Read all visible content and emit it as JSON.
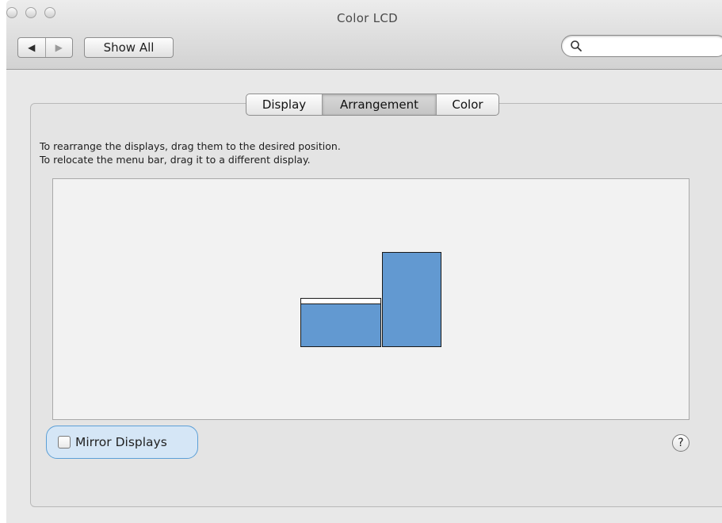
{
  "window": {
    "title": "Color LCD"
  },
  "toolbar": {
    "back_icon": "back-arrow-icon",
    "forward_icon": "forward-arrow-icon",
    "show_all_label": "Show All",
    "search_placeholder": "",
    "search_value": ""
  },
  "tabs": [
    {
      "label": "Display"
    },
    {
      "label": "Arrangement",
      "selected": true
    },
    {
      "label": "Color"
    }
  ],
  "instructions": {
    "line1": "To rearrange the displays, drag them to the desired position.",
    "line2": "To relocate the menu bar, drag it to a different display."
  },
  "arrangement": {
    "displays": [
      {
        "id": "main",
        "has_menu_bar": true
      },
      {
        "id": "secondary",
        "has_menu_bar": false
      }
    ],
    "display_color": "#6299d1"
  },
  "mirror": {
    "label": "Mirror Displays",
    "checked": false
  },
  "help": {
    "glyph": "?"
  }
}
